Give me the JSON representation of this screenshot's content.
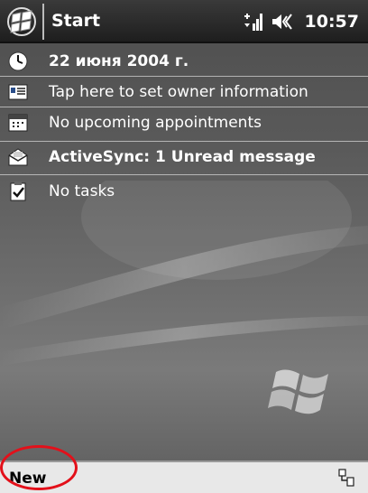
{
  "titlebar": {
    "title": "Start",
    "clock": "10:57",
    "icons": [
      "start-flag-icon",
      "signal-icon",
      "volume-icon"
    ]
  },
  "today": {
    "date": "22 июня 2004 г.",
    "owner": "Tap here to set owner information",
    "calendar": "No upcoming appointments",
    "inbox": "ActiveSync: 1 Unread message",
    "tasks": "No tasks"
  },
  "commandbar": {
    "new_label": "New",
    "icons": [
      "connection-icon"
    ]
  },
  "colors": {
    "titlebar": "#1e1e1e",
    "text": "#ffffff",
    "commandbar": "#e8e8e8",
    "highlight": "#e3101a"
  }
}
